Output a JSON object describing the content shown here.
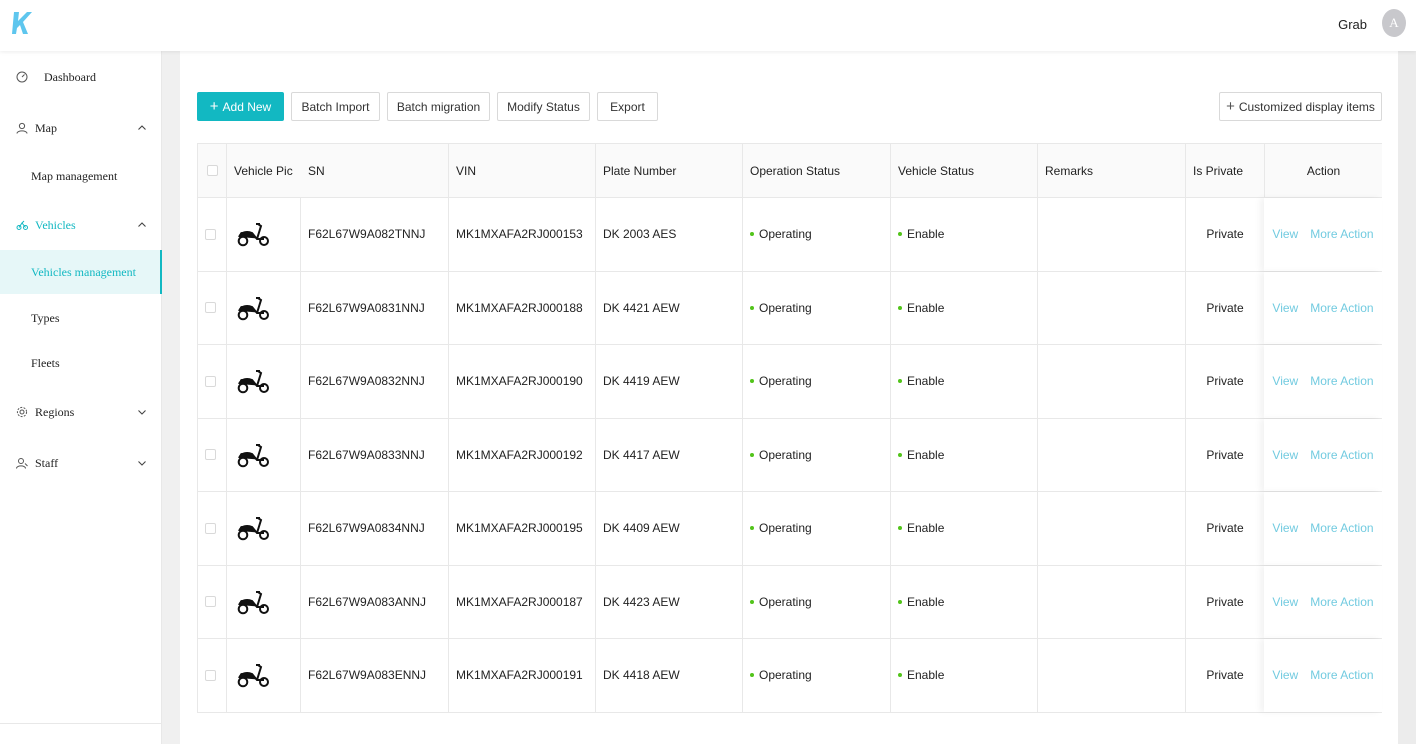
{
  "header": {
    "user_name": "Grab",
    "avatar_letter": "A",
    "accent_color": "#12b8c2"
  },
  "sidebar": {
    "dashboard": "Dashboard",
    "map": "Map",
    "map_management": "Map management",
    "vehicles": "Vehicles",
    "vehicles_management": "Vehicles management",
    "types": "Types",
    "fleets": "Fleets",
    "regions": "Regions",
    "staff": "Staff"
  },
  "toolbar": {
    "add_new": "Add New",
    "batch_import": "Batch Import",
    "batch_migration": "Batch migration",
    "modify_status": "Modify Status",
    "export": "Export",
    "customized_display": "Customized display items"
  },
  "table": {
    "columns": {
      "vehicle_pic": "Vehicle Pic",
      "sn": "SN",
      "vin": "VIN",
      "plate": "Plate Number",
      "op_status": "Operation Status",
      "veh_status": "Vehicle Status",
      "remarks": "Remarks",
      "is_private": "Is Private",
      "action": "Action"
    },
    "rows": [
      {
        "sn": "F62L67W9A082TNNJ",
        "vin": "MK1MXAFA2RJ000153",
        "plate": "DK 2003 AES",
        "op_status": "Operating",
        "veh_status": "Enable",
        "remarks": "",
        "is_private": "Private",
        "view": "View",
        "more": "More Action"
      },
      {
        "sn": "F62L67W9A0831NNJ",
        "vin": "MK1MXAFA2RJ000188",
        "plate": "DK 4421 AEW",
        "op_status": "Operating",
        "veh_status": "Enable",
        "remarks": "",
        "is_private": "Private",
        "view": "View",
        "more": "More Action"
      },
      {
        "sn": "F62L67W9A0832NNJ",
        "vin": "MK1MXAFA2RJ000190",
        "plate": "DK 4419 AEW",
        "op_status": "Operating",
        "veh_status": "Enable",
        "remarks": "",
        "is_private": "Private",
        "view": "View",
        "more": "More Action"
      },
      {
        "sn": "F62L67W9A0833NNJ",
        "vin": "MK1MXAFA2RJ000192",
        "plate": "DK 4417 AEW",
        "op_status": "Operating",
        "veh_status": "Enable",
        "remarks": "",
        "is_private": "Private",
        "view": "View",
        "more": "More Action"
      },
      {
        "sn": "F62L67W9A0834NNJ",
        "vin": "MK1MXAFA2RJ000195",
        "plate": "DK 4409 AEW",
        "op_status": "Operating",
        "veh_status": "Enable",
        "remarks": "",
        "is_private": "Private",
        "view": "View",
        "more": "More Action"
      },
      {
        "sn": "F62L67W9A083ANNJ",
        "vin": "MK1MXAFA2RJ000187",
        "plate": "DK 4423 AEW",
        "op_status": "Operating",
        "veh_status": "Enable",
        "remarks": "",
        "is_private": "Private",
        "view": "View",
        "more": "More Action"
      },
      {
        "sn": "F62L67W9A083ENNJ",
        "vin": "MK1MXAFA2RJ000191",
        "plate": "DK 4418 AEW",
        "op_status": "Operating",
        "veh_status": "Enable",
        "remarks": "",
        "is_private": "Private",
        "view": "View",
        "more": "More Action"
      }
    ]
  }
}
